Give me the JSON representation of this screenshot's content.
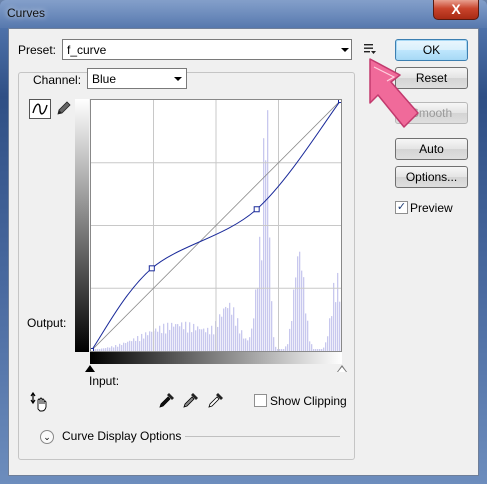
{
  "window": {
    "title": "Curves",
    "close_label": "X"
  },
  "preset": {
    "label": "Preset:",
    "value": "f_curve"
  },
  "channel": {
    "label": "Channel:",
    "value": "Blue"
  },
  "buttons": {
    "ok": "OK",
    "reset": "Reset",
    "smooth": "Smooth",
    "auto": "Auto",
    "options": "Options..."
  },
  "preview": {
    "label": "Preview",
    "checked": true
  },
  "graph": {
    "output_label": "Output:",
    "input_label": "Input:",
    "curve_points": [
      {
        "input": 0,
        "output": 0
      },
      {
        "input": 62,
        "output": 84
      },
      {
        "input": 169,
        "output": 144
      },
      {
        "input": 255,
        "output": 255
      }
    ]
  },
  "show_clipping": {
    "label": "Show Clipping",
    "checked": false
  },
  "display_options": {
    "label": "Curve Display Options"
  },
  "icons": {
    "preset_menu": "preset-options-icon",
    "curve_tool": "curve-point-icon",
    "pencil_tool": "pencil-icon",
    "target_adjust": "hand-adjust-icon",
    "black_eyedropper": "eyedropper-black-icon",
    "gray_eyedropper": "eyedropper-gray-icon",
    "white_eyedropper": "eyedropper-white-icon"
  },
  "colors": {
    "annotation_arrow": "#f06a9a",
    "histogram": "#c8c8ee",
    "curve": "#1a2a9a"
  }
}
